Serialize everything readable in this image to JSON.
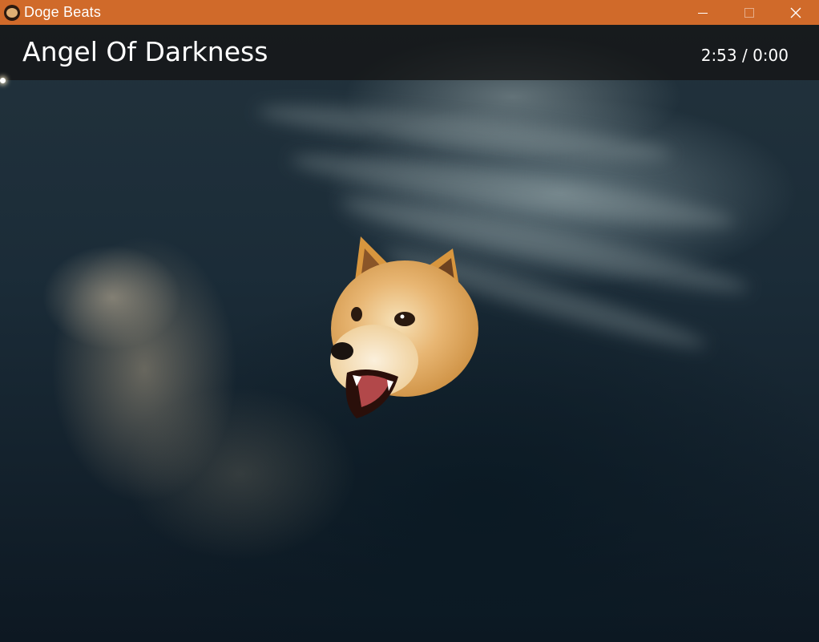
{
  "window": {
    "title": "Doge Beats",
    "controls": [
      "minimize",
      "maximize",
      "close"
    ],
    "title_bar_color": "#d06a2a"
  },
  "player": {
    "song_title": "Angel Of Darkness",
    "time_display": "2:53 / 0:00",
    "progress_fraction": 0.0
  },
  "visualizer": {
    "icon": "doge-head-icon"
  }
}
